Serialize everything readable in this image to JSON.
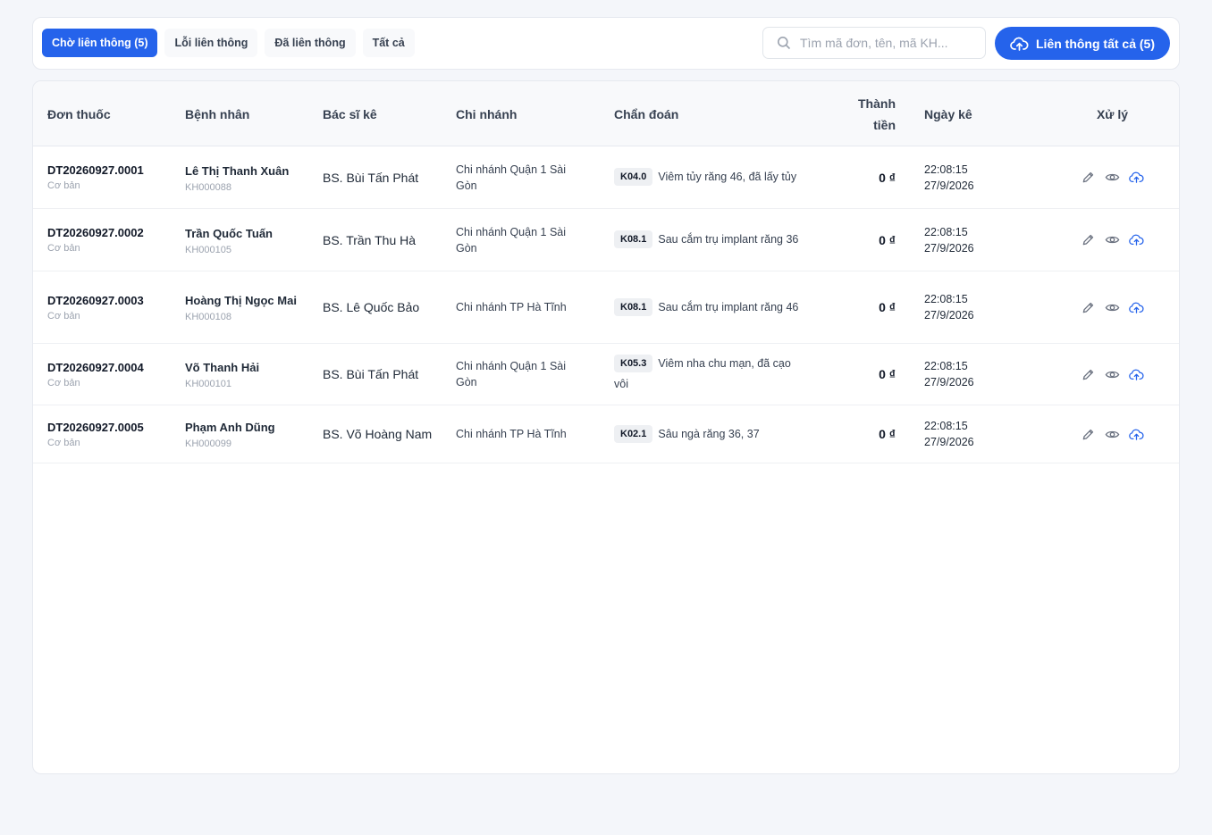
{
  "tabs": [
    {
      "label": "Chờ liên thông (5)",
      "active": true
    },
    {
      "label": "Lỗi liên thông",
      "active": false
    },
    {
      "label": "Đã liên thông",
      "active": false
    },
    {
      "label": "Tất cả",
      "active": false
    }
  ],
  "search": {
    "placeholder": "Tìm mã đơn, tên, mã KH..."
  },
  "sync_all_button": {
    "label": "Liên thông tất cả (5)"
  },
  "columns": {
    "prescription": "Đơn thuốc",
    "patient": "Bệnh nhân",
    "doctor": "Bác sĩ kê",
    "branch": "Chi nhánh",
    "diagnosis": "Chẩn đoán",
    "amount_line1": "Thành",
    "amount_line2": "tiền",
    "date": "Ngày kê",
    "actions": "Xử lý"
  },
  "rows": [
    {
      "code": "DT20260927.0001",
      "type": "Cơ bản",
      "patient": "Lê Thị Thanh Xuân",
      "patient_id": "KH000088",
      "doctor": "BS. Bùi Tấn Phát",
      "branch": "Chi nhánh Quận 1 Sài Gòn",
      "icd": "K04.0",
      "diagnosis": "Viêm tủy răng 46, đã lấy tủy",
      "amount": "0 ₫",
      "time": "22:08:15",
      "date": "27/9/2026"
    },
    {
      "code": "DT20260927.0002",
      "type": "Cơ bản",
      "patient": "Trần Quốc Tuấn",
      "patient_id": "KH000105",
      "doctor": "BS. Trần Thu Hà",
      "branch": "Chi nhánh Quận 1 Sài Gòn",
      "icd": "K08.1",
      "diagnosis": "Sau cắm trụ implant răng 36",
      "amount": "0 ₫",
      "time": "22:08:15",
      "date": "27/9/2026"
    },
    {
      "code": "DT20260927.0003",
      "type": "Cơ bản",
      "patient": "Hoàng Thị Ngọc Mai",
      "patient_id": "KH000108",
      "doctor": "BS. Lê Quốc Bảo",
      "branch": "Chi nhánh TP Hà Tĩnh",
      "icd": "K08.1",
      "diagnosis": "Sau cắm trụ implant răng 46",
      "amount": "0 ₫",
      "time": "22:08:15",
      "date": "27/9/2026"
    },
    {
      "code": "DT20260927.0004",
      "type": "Cơ bản",
      "patient": "Võ Thanh Hải",
      "patient_id": "KH000101",
      "doctor": "BS. Bùi Tấn Phát",
      "branch": "Chi nhánh Quận 1 Sài Gòn",
      "icd": "K05.3",
      "diagnosis": "Viêm nha chu mạn, đã cạo vôi",
      "amount": "0 ₫",
      "time": "22:08:15",
      "date": "27/9/2026"
    },
    {
      "code": "DT20260927.0005",
      "type": "Cơ bản",
      "patient": "Phạm Anh Dũng",
      "patient_id": "KH000099",
      "doctor": "BS. Võ Hoàng Nam",
      "branch": "Chi nhánh TP Hà Tĩnh",
      "icd": "K02.1",
      "diagnosis": "Sâu ngà răng 36, 37",
      "amount": "0 ₫",
      "time": "22:08:15",
      "date": "27/9/2026"
    }
  ],
  "icons": {
    "search": "search-icon",
    "cloud_upload": "cloud-upload-icon",
    "edit": "pencil-icon",
    "view": "eye-icon"
  },
  "colors": {
    "primary": "#2563eb",
    "background": "#f4f6fa"
  }
}
